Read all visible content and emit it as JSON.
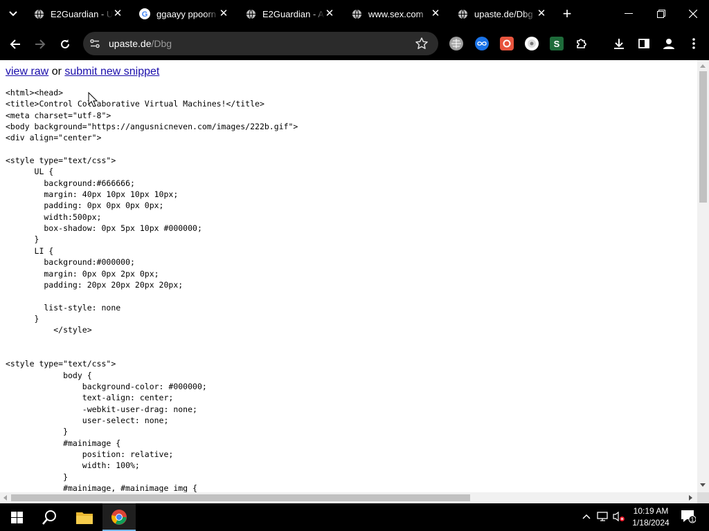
{
  "browser": {
    "tabs": [
      {
        "title": "E2Guardian - U",
        "favicon": "globe-icon",
        "active": false
      },
      {
        "title": "ggaayy ppoorn",
        "favicon": "google-icon",
        "active": false
      },
      {
        "title": "E2Guardian - A",
        "favicon": "globe-icon",
        "active": false
      },
      {
        "title": "www.sex.com",
        "favicon": "globe-icon",
        "active": false
      },
      {
        "title": "upaste.de/Dbg",
        "favicon": "globe-icon",
        "active": true
      }
    ],
    "address": {
      "host": "upaste.de",
      "path": "/Dbg"
    },
    "extensions": [
      "globe-extension-icon",
      "infinity-extension-icon",
      "record-extension-icon",
      "chrome-extension-icon",
      "s-extension-icon",
      "puzzle-extensions-icon"
    ]
  },
  "page": {
    "view_raw": "view raw",
    "or": "or",
    "submit_snippet": "submit new snippet",
    "code_lines": [
      "<html><head>",
      "<title>Control Collaborative Virtual Machines!</title>",
      "<meta charset=\"utf-8\">",
      "<body background=\"https://angusnicneven.com/images/222b.gif\">",
      "<div align=\"center\">",
      "",
      "<style type=\"text/css\">",
      "      UL {",
      "        background:#666666;",
      "        margin: 40px 10px 10px 10px;",
      "        padding: 0px 0px 0px 0px;",
      "        width:500px;",
      "        box-shadow: 0px 5px 10px #000000;",
      "      }",
      "      LI {",
      "        background:#000000;",
      "        margin: 0px 0px 2px 0px;",
      "        padding: 20px 20px 20px 20px;",
      "",
      "        list-style: none",
      "      }",
      "          </style>",
      "",
      "",
      "<style type=\"text/css\">",
      "            body {",
      "                background-color: #000000;",
      "                text-align: center;",
      "                -webkit-user-drag: none;",
      "                user-select: none;",
      "            }",
      "            #mainimage {",
      "                position: relative;",
      "                width: 100%;",
      "            }",
      "            #mainimage, #mainimage img {"
    ]
  },
  "taskbar": {
    "time": "10:19 AM",
    "date": "1/18/2024",
    "notification_count": "1"
  }
}
